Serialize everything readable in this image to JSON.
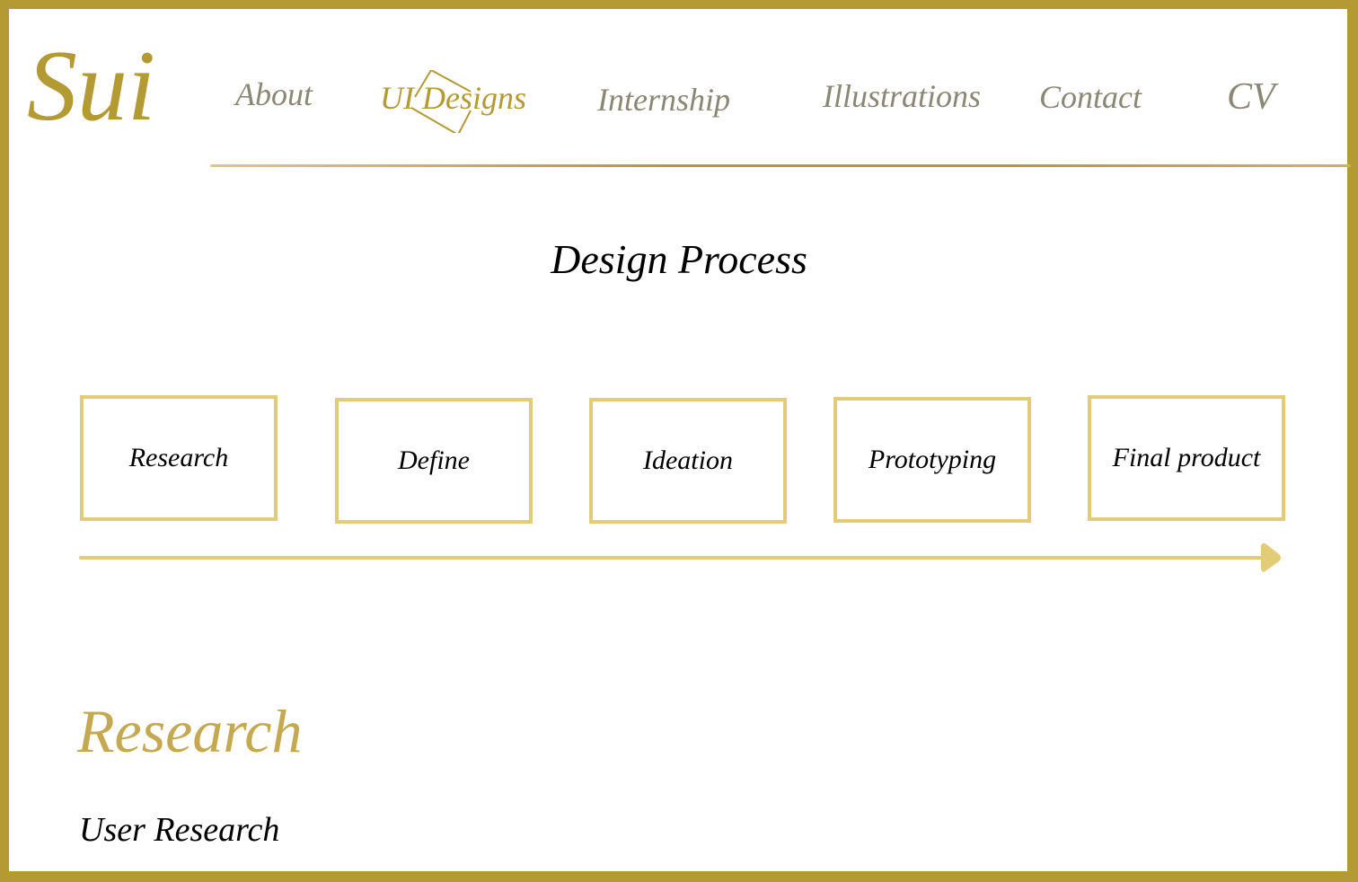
{
  "logo": "Sui",
  "nav": [
    {
      "label": "About"
    },
    {
      "label": "UI Designs",
      "active": true
    },
    {
      "label": "Internship"
    },
    {
      "label": "Illustrations"
    },
    {
      "label": "Contact"
    },
    {
      "label": "CV"
    }
  ],
  "section_title": "Design Process",
  "steps": [
    {
      "label": "Research"
    },
    {
      "label": "Define"
    },
    {
      "label": "Ideation"
    },
    {
      "label": "Prototyping"
    },
    {
      "label": "Final product"
    }
  ],
  "heading": "Research",
  "subheading": "User Research",
  "colors": {
    "gold": "#b39a33",
    "light_gold": "#e2cc78",
    "nav_gray": "#8a8775"
  }
}
